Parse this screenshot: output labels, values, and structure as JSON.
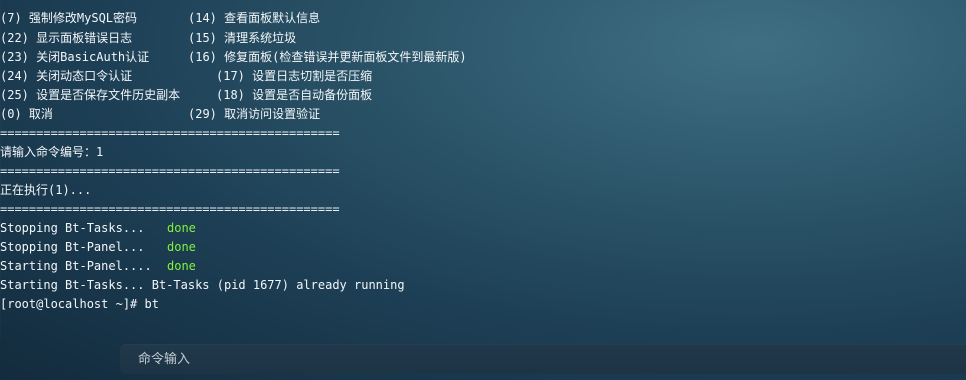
{
  "terminal": {
    "menu": [
      {
        "left": "(7) 强制修改MySQL密码",
        "right": "(14) 查看面板默认信息"
      },
      {
        "left": "(22) 显示面板错误日志",
        "right": "(15) 清理系统垃圾"
      },
      {
        "left": "(23) 关闭BasicAuth认证",
        "right": "(16) 修复面板(检查错误并更新面板文件到最新版)"
      },
      {
        "left": "(24) 关闭动态口令认证",
        "right": "(17) 设置日志切割是否压缩"
      },
      {
        "left": "(25) 设置是否保存文件历史副本",
        "right": "(18) 设置是否自动备份面板"
      },
      {
        "left": "(0) 取消",
        "right": "(29) 取消访问设置验证"
      }
    ],
    "separator": "===============================================",
    "input_prompt": "请输入命令编号：1",
    "executing": "正在执行(1)...",
    "status_lines": [
      {
        "label": "Stopping Bt-Tasks...",
        "status": "done"
      },
      {
        "label": "Stopping Bt-Panel...",
        "status": "done"
      },
      {
        "label": "Starting Bt-Panel....",
        "status": "done"
      }
    ],
    "running_line": "Starting Bt-Tasks... Bt-Tasks (pid 1677) already running",
    "shell_prompt": "[root@localhost ~]# bt"
  },
  "command_bar": {
    "placeholder": "命令输入"
  }
}
